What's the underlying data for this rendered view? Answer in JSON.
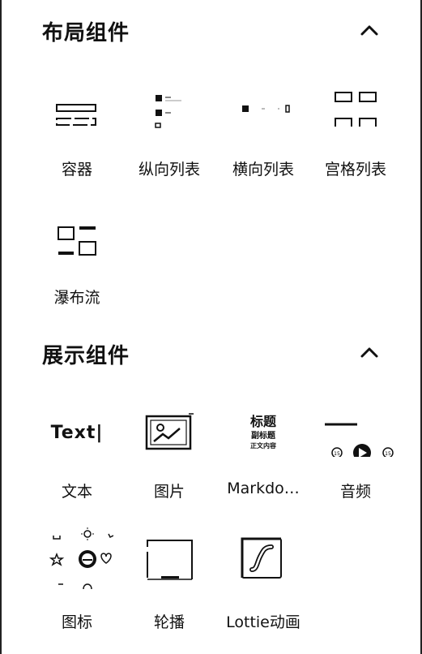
{
  "sections": [
    {
      "title": "布局组件",
      "collapse_icon": "chevron-up-icon",
      "items": [
        {
          "label": "容器",
          "icon": "container-icon"
        },
        {
          "label": "纵向列表",
          "icon": "vertical-list-icon"
        },
        {
          "label": "横向列表",
          "icon": "horizontal-list-icon"
        },
        {
          "label": "宫格列表",
          "icon": "grid-list-icon"
        },
        {
          "label": "瀑布流",
          "icon": "waterfall-icon"
        }
      ]
    },
    {
      "title": "展示组件",
      "collapse_icon": "chevron-up-icon",
      "items": [
        {
          "label": "文本",
          "icon": "text-icon",
          "icon_text": "Text|"
        },
        {
          "label": "图片",
          "icon": "image-icon"
        },
        {
          "label": "Markdo…",
          "icon": "markdown-icon",
          "icon_lines": [
            "标题",
            "副标题",
            "正文内容"
          ]
        },
        {
          "label": "音频",
          "icon": "audio-icon"
        },
        {
          "label": "图标",
          "icon": "icons-icon"
        },
        {
          "label": "轮播",
          "icon": "carousel-icon"
        },
        {
          "label": "Lottie动画",
          "icon": "lottie-icon"
        }
      ]
    }
  ]
}
